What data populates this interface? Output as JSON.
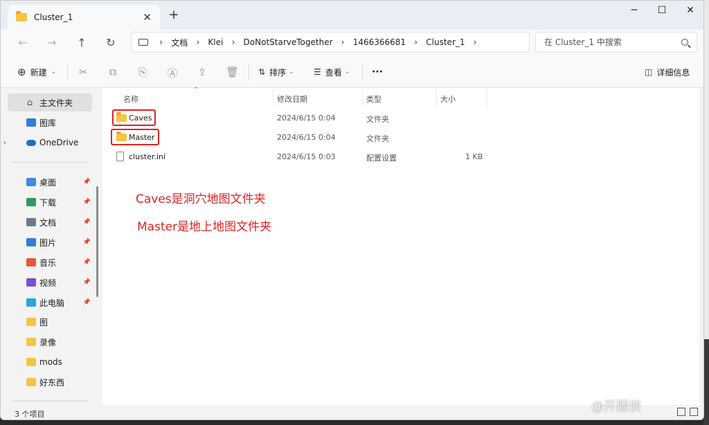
{
  "window": {
    "tab_title": "Cluster_1",
    "tab_close": "✕",
    "new_tab": "+",
    "controls": {
      "minimize": "─",
      "maximize": "☐",
      "close": "✕"
    }
  },
  "address": {
    "nav": {
      "back": "←",
      "forward": "→",
      "up": "↑",
      "refresh": "↻"
    },
    "crumbs": [
      "文档",
      "Klei",
      "DoNotStarveTogether",
      "1466366681",
      "Cluster_1"
    ],
    "separator": "›",
    "search_placeholder": "在 Cluster_1 中搜索"
  },
  "commandbar": {
    "new_label": "新建",
    "sort_label": "排序",
    "view_label": "查看",
    "more_label": "···",
    "details_label": "详细信息"
  },
  "sidebar": {
    "home": "主文件夹",
    "gallery": "图库",
    "onedrive": "OneDrive",
    "pinned": [
      {
        "label": "桌面",
        "icon": "desktop-icon",
        "color": "#3a8ee6"
      },
      {
        "label": "下载",
        "icon": "download-icon",
        "color": "#2e9b5b"
      },
      {
        "label": "文档",
        "icon": "document-icon",
        "color": "#6a7a8c"
      },
      {
        "label": "图片",
        "icon": "pictures-icon",
        "color": "#2f7fd8"
      },
      {
        "label": "音乐",
        "icon": "music-icon",
        "color": "#e05a3a"
      },
      {
        "label": "视频",
        "icon": "video-icon",
        "color": "#7a4fd6"
      },
      {
        "label": "此电脑",
        "icon": "pc-icon",
        "color": "#2aa6d8"
      }
    ],
    "folders": [
      "图",
      "录像",
      "mods",
      "好东西"
    ]
  },
  "columns": {
    "name": "名称",
    "date": "修改日期",
    "type": "类型",
    "size": "大小"
  },
  "files": [
    {
      "name": "Caves",
      "date": "2024/6/15 0:04",
      "type": "文件夹",
      "size": ""
    },
    {
      "name": "Master",
      "date": "2024/6/15 0:04",
      "type": "文件夹",
      "size": ""
    },
    {
      "name": "cluster.ini",
      "date": "2024/6/15 0:03",
      "type": "配置设置",
      "size": "1 KB"
    }
  ],
  "annotations": {
    "caves": "Caves是洞穴地图文件夹",
    "master": "Master是地上地图文件夹"
  },
  "status": {
    "count": "3 个项目"
  },
  "watermark": "@开服侠",
  "colors": {
    "annotation": "#e02020",
    "folder": "#f5c542"
  }
}
